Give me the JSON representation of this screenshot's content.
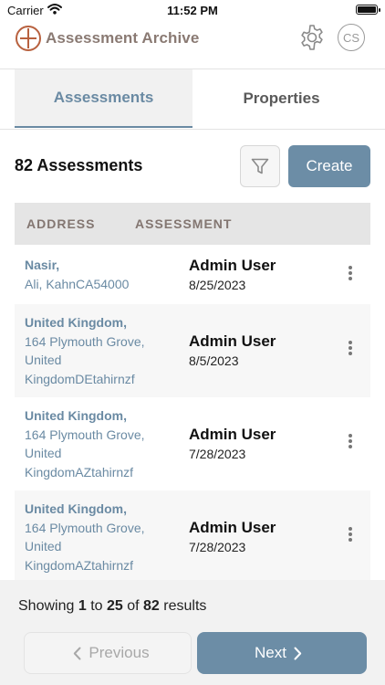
{
  "status_bar": {
    "carrier": "Carrier",
    "time": "11:52 PM"
  },
  "header": {
    "app_name": "Assessment Archive",
    "avatar_initials": "CS"
  },
  "tabs": [
    {
      "label": "Assessments",
      "active": true
    },
    {
      "label": "Properties",
      "active": false
    }
  ],
  "toolbar": {
    "count_label": "82 Assessments",
    "create_label": "Create"
  },
  "table": {
    "columns": [
      "ADDRESS",
      "ASSESSMENT"
    ],
    "rows": [
      {
        "address_line1": "Nasir,",
        "address_line2": "Ali, KahnCA54000",
        "assessor": "Admin User",
        "date": "8/25/2023"
      },
      {
        "address_line1": "United Kingdom,",
        "address_line2": "164 Plymouth Grove, United KingdomDEtahirnzf",
        "assessor": "Admin User",
        "date": "8/5/2023"
      },
      {
        "address_line1": "United Kingdom,",
        "address_line2": "164 Plymouth Grove, United KingdomAZtahirnzf",
        "assessor": "Admin User",
        "date": "7/28/2023"
      },
      {
        "address_line1": "United Kingdom,",
        "address_line2": "164 Plymouth Grove, United KingdomAZtahirnzf",
        "assessor": "Admin User",
        "date": "7/28/2023"
      }
    ]
  },
  "pagination": {
    "showing_word": "Showing",
    "from": "1",
    "to_word": "to",
    "to": "25",
    "of_word": "of",
    "total": "82",
    "results_word": "results",
    "previous_label": "Previous",
    "next_label": "Next"
  },
  "colors": {
    "accent": "#6c8da6",
    "address_text": "#6a8aa3",
    "logo": "#8a7a73",
    "logo_mark": "#b8613f"
  },
  "icons": [
    "wifi-icon",
    "battery-icon",
    "logo-icon",
    "gear-icon",
    "filter-icon",
    "more-vertical-icon",
    "chevron-left-icon",
    "chevron-right-icon"
  ]
}
